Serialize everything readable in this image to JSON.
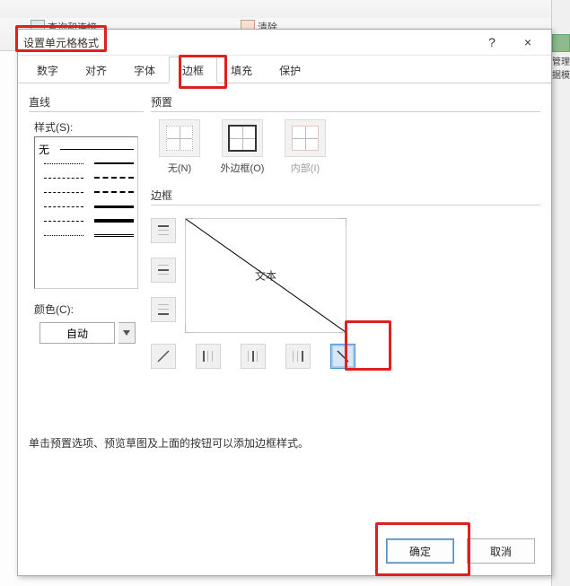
{
  "ribbon": {
    "btn1": "查询和连接",
    "btn2": "清除",
    "right_label1": "管理",
    "right_label2": "据模"
  },
  "dialog": {
    "title": "设置单元格格式",
    "help": "?",
    "close": "×"
  },
  "tabs": {
    "items": [
      "数字",
      "对齐",
      "字体",
      "边框",
      "填充",
      "保护"
    ],
    "active_index": 3
  },
  "line": {
    "section": "直线",
    "style_label": "样式(S):",
    "none_label": "无",
    "color_label": "颜色(C):",
    "color_value": "自动"
  },
  "presets": {
    "section": "预置",
    "items": [
      {
        "label": "无(N)"
      },
      {
        "label": "外边框(O)"
      },
      {
        "label": "内部(I)",
        "disabled": true
      }
    ]
  },
  "border": {
    "section": "边框",
    "preview_text": "文本"
  },
  "hint": "单击预置选项、预览草图及上面的按钮可以添加边框样式。",
  "buttons": {
    "ok": "确定",
    "cancel": "取消"
  }
}
